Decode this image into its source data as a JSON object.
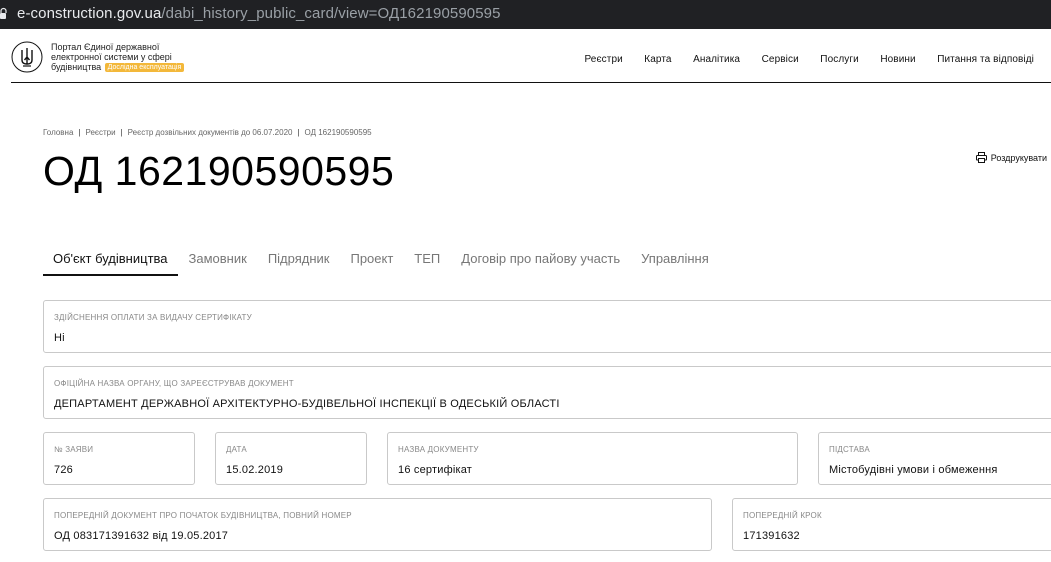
{
  "browser": {
    "url_host": "e-construction.gov.ua",
    "url_path": "/dabi_history_public_card/view=ОД162190590595"
  },
  "header": {
    "brand_line1": "Портал Єдиної державної",
    "brand_line2": "електронної системи у сфері",
    "brand_line3": "будівництва",
    "badge": "Дослідна експлуатація",
    "nav": [
      "Реєстри",
      "Карта",
      "Аналітика",
      "Сервіси",
      "Послуги",
      "Новини",
      "Питання та відповіді"
    ]
  },
  "breadcrumb": [
    "Головна",
    "Реєстри",
    "Реєстр дозвільних документів до 06.07.2020",
    "ОД 162190590595"
  ],
  "page_title": "ОД 162190590595",
  "print_label": "Роздрукувати",
  "tabs": [
    {
      "label": "Об'єкт будівництва",
      "active": true
    },
    {
      "label": "Замовник",
      "active": false
    },
    {
      "label": "Підрядник",
      "active": false
    },
    {
      "label": "Проект",
      "active": false
    },
    {
      "label": "ТЕП",
      "active": false
    },
    {
      "label": "Договір про пайову участь",
      "active": false
    },
    {
      "label": "Управління",
      "active": false
    }
  ],
  "fields": {
    "payment": {
      "label": "Здійснення оплати за видачу сертифікату",
      "value": "Ні"
    },
    "authority": {
      "label": "Офіційна назва органу, що зареєстрував документ",
      "value": "ДЕПАРТАМЕНТ ДЕРЖАВНОЇ АРХІТЕКТУРНО-БУДІВЕЛЬНОЇ ІНСПЕКЦІЇ В ОДЕСЬКІЙ ОБЛАСТІ"
    },
    "application_no": {
      "label": "№ заяви",
      "value": "726"
    },
    "date": {
      "label": "Дата",
      "value": "15.02.2019"
    },
    "doc_name": {
      "label": "Назва документу",
      "value": "16 сертифікат"
    },
    "basis": {
      "label": "Підстава",
      "value": "Містобудівні умови і обмеження"
    },
    "prev_doc": {
      "label": "Попередній документ про початок будівництва, повний номер",
      "value": "ОД 083171391632 від 19.05.2017"
    },
    "prev_step": {
      "label": "Попередній крок",
      "value": "171391632"
    }
  }
}
